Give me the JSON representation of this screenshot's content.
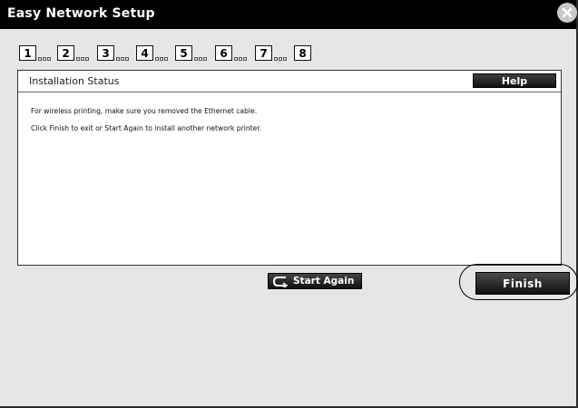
{
  "window": {
    "title": "Easy Network Setup",
    "close_icon": "close-icon"
  },
  "steps": [
    "1",
    "2",
    "3",
    "4",
    "5",
    "6",
    "7",
    "8"
  ],
  "panel": {
    "title": "Installation Status",
    "help_label": "Help",
    "messages": [
      "For wireless printing, make sure you removed the Ethernet cable.",
      "Click Finish to exit or Start Again to install another network printer."
    ]
  },
  "buttons": {
    "start_again": "Start Again",
    "start_again_icon": "undo-arrow-icon",
    "finish": "Finish"
  },
  "colors": {
    "titlebar": "#000000",
    "window_bg": "#e6e6e6",
    "button_bg": "#1a1a1a",
    "panel_bg": "#ffffff"
  }
}
